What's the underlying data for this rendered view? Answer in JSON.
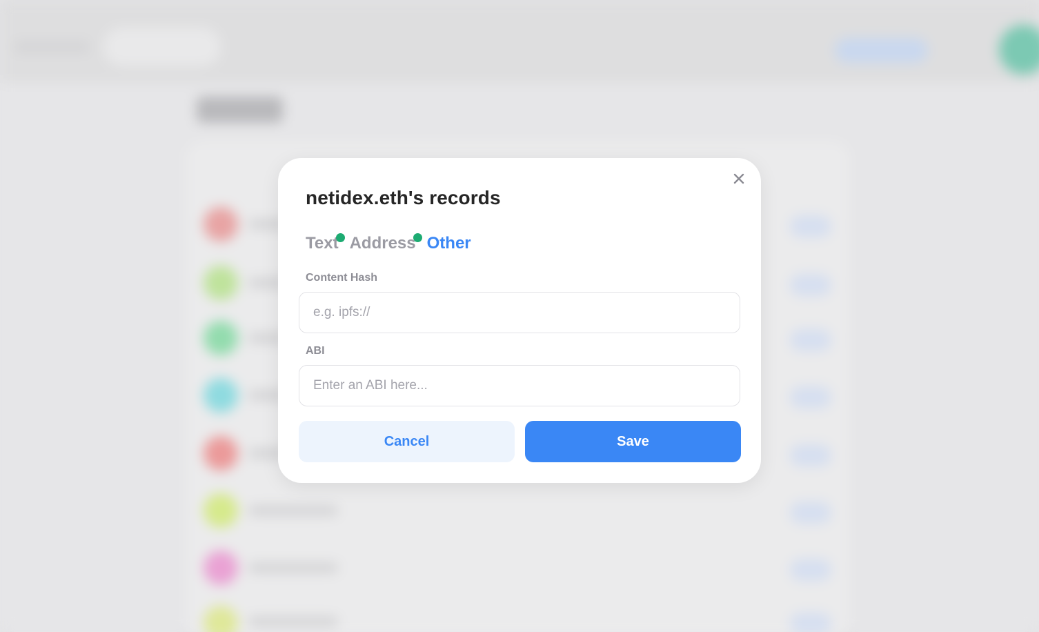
{
  "modal": {
    "title": "netidex.eth's records",
    "tabs": [
      {
        "label": "Text",
        "has_changes": true,
        "active": false
      },
      {
        "label": "Address",
        "has_changes": true,
        "active": false
      },
      {
        "label": "Other",
        "has_changes": false,
        "active": true
      }
    ],
    "fields": [
      {
        "label": "Content Hash",
        "placeholder": "e.g. ipfs://",
        "value": ""
      },
      {
        "label": "ABI",
        "placeholder": "Enter an ABI here...",
        "value": ""
      }
    ],
    "cancel_label": "Cancel",
    "save_label": "Save"
  },
  "icons": {
    "close": "close-icon"
  },
  "colors": {
    "accent": "#3a87f5",
    "indicator": "#1dab72",
    "muted_text": "#9b9ba3",
    "cancel_bg": "#edf4fd"
  }
}
